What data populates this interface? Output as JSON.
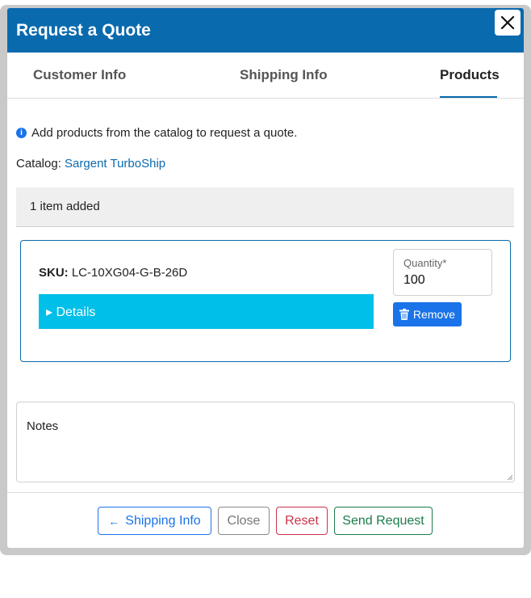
{
  "dialog": {
    "title": "Request a Quote"
  },
  "tabs": [
    {
      "label": "Customer Info",
      "active": false
    },
    {
      "label": "Shipping Info",
      "active": false
    },
    {
      "label": "Products",
      "active": true
    }
  ],
  "info": {
    "icon": "info-circle-icon",
    "text": "Add products from the catalog to request a quote."
  },
  "catalog": {
    "label": "Catalog:",
    "name": "Sargent TurboShip"
  },
  "summary": {
    "text": "1 item added"
  },
  "product": {
    "sku_label": "SKU:",
    "sku_value": "LC-10XG04-G-B-26D",
    "details_label": "▸ Details",
    "quantity_label": "Quantity*",
    "quantity_value": "100",
    "remove_label": "Remove"
  },
  "notes": {
    "placeholder": "Notes"
  },
  "footer": {
    "back_label": "Shipping Info",
    "close_label": "Close",
    "reset_label": "Reset",
    "send_label": "Send Request"
  },
  "colors": {
    "header": "#0a6aae",
    "details_bar": "#00bfe8",
    "primary": "#1a73e8",
    "danger": "#c8334a",
    "success": "#1b7b4b"
  }
}
